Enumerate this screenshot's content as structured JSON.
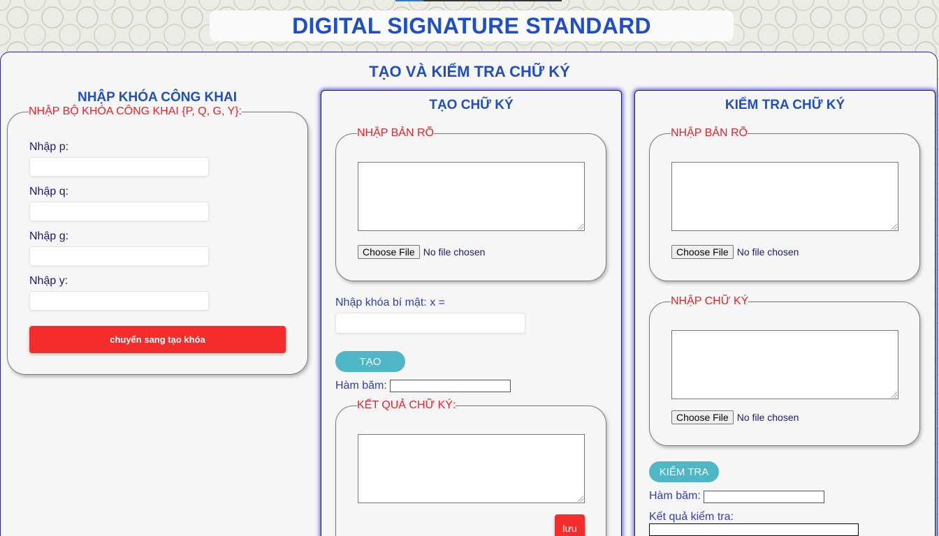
{
  "app": {
    "title": "DIGITAL SIGNATURE STANDARD",
    "page_title": "TẠO VÀ KIỂM TRA CHỮ KÝ"
  },
  "public_key": {
    "title": "NHẬP KHÓA CÔNG KHAI",
    "legend": "NHẬP BỘ KHÓA CÔNG KHAI {P, Q, G, Y}:",
    "fields": [
      {
        "label": "Nhập p:",
        "value": ""
      },
      {
        "label": "Nhập q:",
        "value": ""
      },
      {
        "label": "Nhập g:",
        "value": ""
      },
      {
        "label": "Nhập y:",
        "value": ""
      }
    ],
    "button_label": "chuyển sang tạo khóa"
  },
  "create": {
    "title": "TẠO CHỮ KÝ",
    "plaintext_legend": "NHẬP BẢN RÕ",
    "plaintext_value": "",
    "file_button": "Choose File",
    "file_status": "No file chosen",
    "secret_key_label": "Nhập khóa bí mật: x =",
    "secret_key_value": "",
    "create_button": "TẠO",
    "hash_label": "Hàm băm:",
    "hash_value": "",
    "result_legend": "KẾT QUẢ CHỮ KÝ:",
    "result_value": "",
    "save_button": "lưu"
  },
  "verify": {
    "title": "KIỂM TRA CHỮ KÝ",
    "plaintext_legend": "NHẬP BẢN RÕ",
    "plaintext_value": "",
    "file_button": "Choose File",
    "file_status": "No file chosen",
    "signature_legend": "NHẬP CHỮ KÝ",
    "signature_value": "",
    "signature_file_button": "Choose File",
    "signature_file_status": "No file chosen",
    "verify_button": "KIỂM TRA",
    "hash_label": "Hàm băm:",
    "hash_value": "",
    "result_label": "Kết quả kiểm tra:",
    "result_value": ""
  },
  "colors": {
    "title_blue": "#1f4fc6",
    "legend_red": "#e8232a",
    "button_red": "#f52c2c",
    "button_teal": "#4fb6c6",
    "card_glow": "#6a6af0"
  }
}
